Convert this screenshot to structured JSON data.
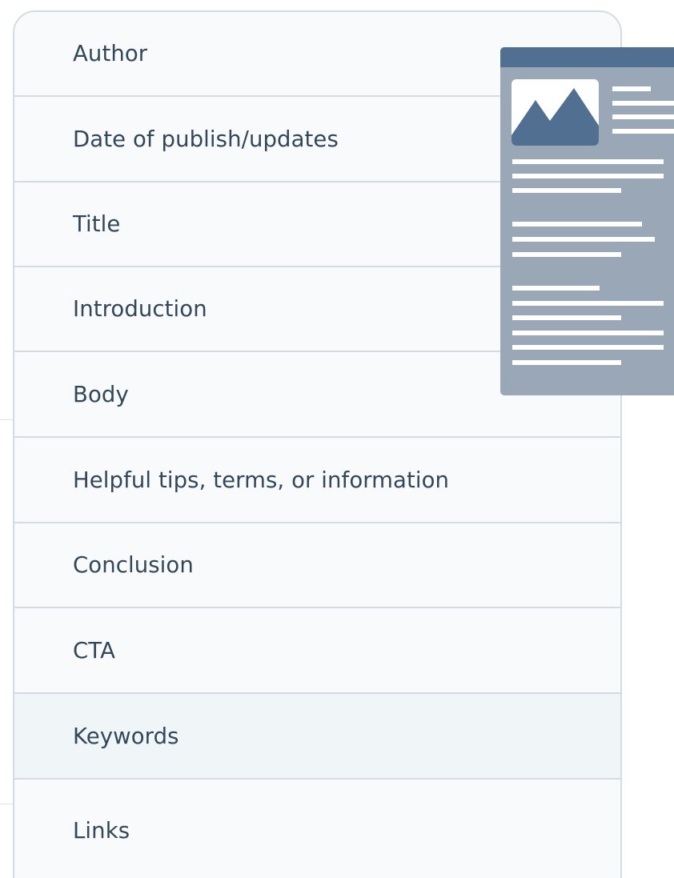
{
  "checklist": {
    "items": [
      "Author",
      "Date of publish/updates",
      "Title",
      "Introduction",
      "Body",
      "Helpful tips, terms, or information",
      "Conclusion",
      "CTA",
      "Keywords",
      "Links"
    ],
    "highlighted_item": "Keywords"
  },
  "document_illustration": {
    "icon": "image-placeholder-icon",
    "header_color": "#516f90",
    "page_color": "#9aa7b6"
  },
  "colors": {
    "text": "#33475b",
    "border": "#d3dbe5",
    "panel_background": "#f8fafc",
    "highlight_background": "#f0f5f8"
  }
}
